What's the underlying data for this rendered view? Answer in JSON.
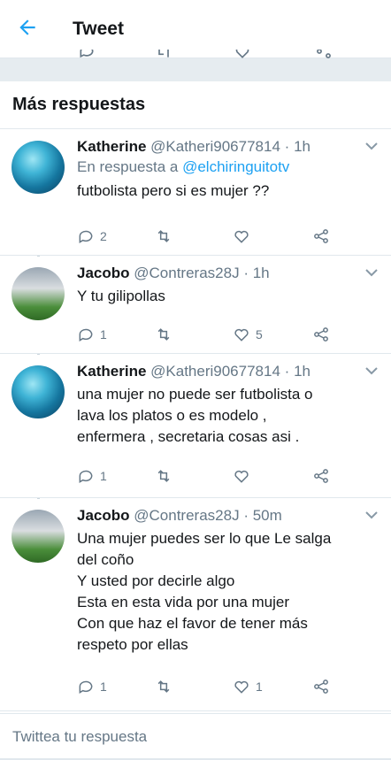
{
  "header": {
    "title": "Tweet",
    "back_icon": "back-arrow-icon"
  },
  "section": {
    "title": "Más respuestas"
  },
  "tweets": [
    {
      "name": "Katherine",
      "handle": "@Katheri90677814",
      "sep": "·",
      "time": "1h",
      "reply_prefix": "En respuesta a",
      "reply_handle": "@elchiringuitotv",
      "lines": [
        "futbolista pero si es mujer ??"
      ],
      "replies": "2",
      "retweets": "",
      "likes": ""
    },
    {
      "name": "Jacobo",
      "handle": "@Contreras28J",
      "sep": "·",
      "time": "1h",
      "lines": [
        "Y tu gilipollas"
      ],
      "replies": "1",
      "retweets": "",
      "likes": "5"
    },
    {
      "name": "Katherine",
      "handle": "@Katheri90677814",
      "sep": "·",
      "time": "1h",
      "lines": [
        "una mujer no puede ser futbolista o",
        "lava los platos o es modelo ,",
        "enfermera , secretaria cosas asi ."
      ],
      "replies": "1",
      "retweets": "",
      "likes": ""
    },
    {
      "name": "Jacobo",
      "handle": "@Contreras28J",
      "sep": "·",
      "time": "50m",
      "lines": [
        "Una mujer puedes ser lo que Le salga",
        "del coño",
        "Y usted por decirle algo",
        "Esta en esta vida por una mujer",
        "Con que haz el favor de tener más",
        "respeto por ellas"
      ],
      "replies": "1",
      "retweets": "",
      "likes": "1"
    }
  ],
  "compose": {
    "placeholder": "Twittea tu respuesta"
  },
  "colors": {
    "accent": "#1da1f2",
    "muted": "#657786",
    "divider": "#e1e8ed",
    "band": "#e6ecf0"
  }
}
